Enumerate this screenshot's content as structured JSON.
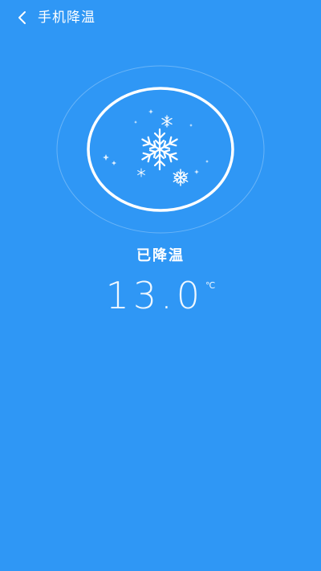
{
  "header": {
    "back_icon": "chevron-left-icon",
    "title": "手机降温"
  },
  "cooling": {
    "icon": "snowflake-icon",
    "status": "已降温",
    "temperature": "13.0",
    "unit": "℃"
  },
  "colors": {
    "background": "#2f97f5",
    "text": "#ffffff"
  }
}
